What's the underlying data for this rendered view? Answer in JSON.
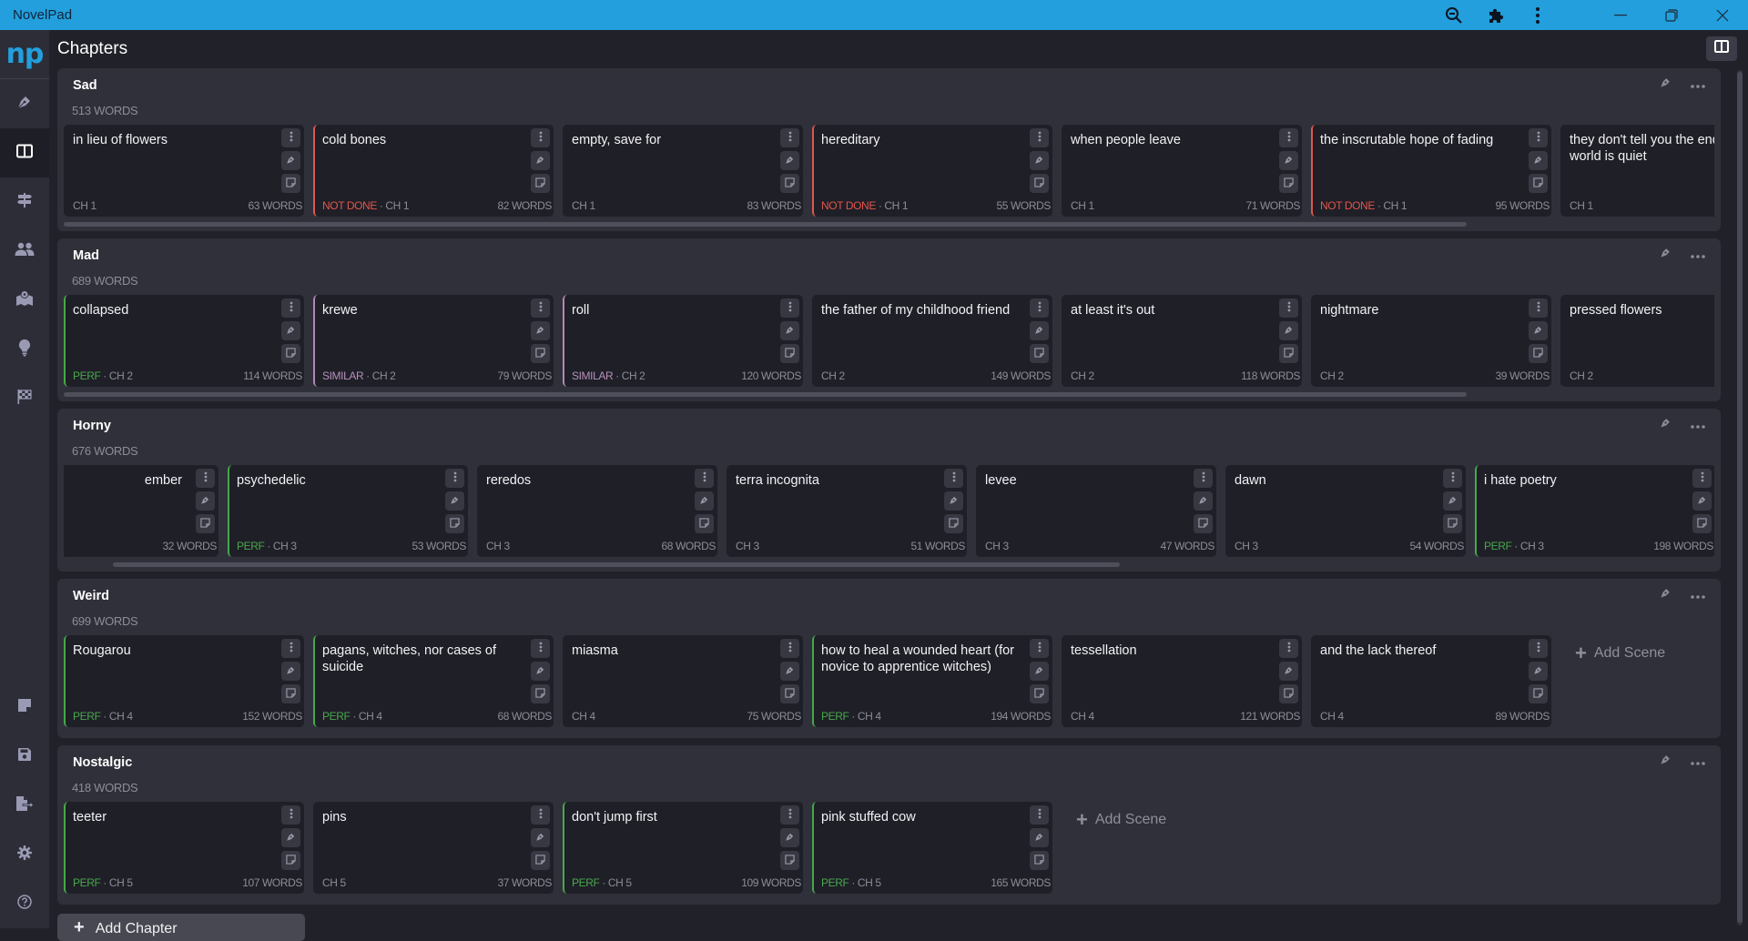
{
  "app": {
    "title": "NovelPad",
    "logo": "np",
    "page_title": "Chapters",
    "titlebar_icons": [
      "zoom-out-icon",
      "extension-puzzle-icon",
      "more-vert-icon"
    ],
    "window_controls": [
      "minimize",
      "restore",
      "close"
    ],
    "colors": {
      "titlebar": "#229fdc",
      "perf": "#48a84c",
      "not_done": "#e2554c",
      "similar": "#b791bd"
    }
  },
  "sidebar": {
    "top_items": [
      {
        "name": "write",
        "icon": "pen-nib-icon"
      },
      {
        "name": "chapters",
        "icon": "board-icon",
        "active": true
      },
      {
        "name": "plot",
        "icon": "signpost-icon"
      },
      {
        "name": "characters",
        "icon": "people-icon"
      },
      {
        "name": "locations",
        "icon": "map-pin-icon"
      },
      {
        "name": "ideas",
        "icon": "lightbulb-icon"
      },
      {
        "name": "goals",
        "icon": "checkered-flag-icon"
      }
    ],
    "bottom_items": [
      {
        "name": "notes",
        "icon": "sticky-note-icon"
      },
      {
        "name": "save",
        "icon": "floppy-disk-icon"
      },
      {
        "name": "export",
        "icon": "file-export-icon"
      },
      {
        "name": "settings",
        "icon": "gear-icon"
      },
      {
        "name": "help",
        "icon": "question-circle-icon"
      }
    ]
  },
  "chapters": [
    {
      "name": "Sad",
      "words": "513 WORDS",
      "scroll": {
        "thumb_start": 0.0,
        "thumb_end": 0.85
      },
      "offset": 0,
      "scenes": [
        {
          "title": "in lieu of flowers",
          "status": "",
          "chapter": "CH 1",
          "words": "63 WORDS"
        },
        {
          "title": "cold bones",
          "status": "NOT DONE",
          "chapter": "CH 1",
          "words": "82 WORDS"
        },
        {
          "title": "empty, save for",
          "status": "",
          "chapter": "CH 1",
          "words": "83 WORDS"
        },
        {
          "title": "hereditary",
          "status": "NOT DONE",
          "chapter": "CH 1",
          "words": "55 WORDS"
        },
        {
          "title": "when people leave",
          "status": "",
          "chapter": "CH 1",
          "words": "71 WORDS"
        },
        {
          "title": "the inscrutable hope of fading",
          "status": "NOT DONE",
          "chapter": "CH 1",
          "words": "95 WORDS"
        },
        {
          "title": "they don't tell you the end the world is quiet",
          "status": "",
          "chapter": "CH 1",
          "words": ""
        }
      ],
      "add_scene": ""
    },
    {
      "name": "Mad",
      "words": "689 WORDS",
      "scroll": {
        "thumb_start": 0.0,
        "thumb_end": 0.85
      },
      "offset": 0,
      "scenes": [
        {
          "title": "collapsed",
          "status": "PERF",
          "chapter": "CH 2",
          "words": "114 WORDS"
        },
        {
          "title": "krewe",
          "status": "SIMILAR",
          "chapter": "CH 2",
          "words": "79 WORDS"
        },
        {
          "title": "roll",
          "status": "SIMILAR",
          "chapter": "CH 2",
          "words": "120 WORDS"
        },
        {
          "title": "the father of my childhood friend",
          "status": "",
          "chapter": "CH 2",
          "words": "149 WORDS"
        },
        {
          "title": "at least it's out",
          "status": "",
          "chapter": "CH 2",
          "words": "118 WORDS"
        },
        {
          "title": "nightmare",
          "status": "",
          "chapter": "CH 2",
          "words": "39 WORDS"
        },
        {
          "title": "pressed flowers",
          "status": "",
          "chapter": "CH 2",
          "words": ""
        }
      ],
      "add_scene": ""
    },
    {
      "name": "Horny",
      "words": "676 WORDS",
      "scroll": {
        "thumb_start": 0.03,
        "thumb_end": 0.64
      },
      "offset": 1,
      "scenes": [
        {
          "title": "ember",
          "status": "",
          "chapter": "",
          "words": "32 WORDS"
        },
        {
          "title": "psychedelic",
          "status": "PERF",
          "chapter": "CH 3",
          "words": "53 WORDS"
        },
        {
          "title": "reredos",
          "status": "",
          "chapter": "CH 3",
          "words": "68 WORDS"
        },
        {
          "title": "terra incognita",
          "status": "",
          "chapter": "CH 3",
          "words": "51 WORDS"
        },
        {
          "title": "levee",
          "status": "",
          "chapter": "CH 3",
          "words": "47 WORDS"
        },
        {
          "title": "dawn",
          "status": "",
          "chapter": "CH 3",
          "words": "54 WORDS"
        },
        {
          "title": "i hate poetry",
          "status": "PERF",
          "chapter": "CH 3",
          "words": "198 WORDS"
        }
      ],
      "add_scene": ""
    },
    {
      "name": "Weird",
      "words": "699 WORDS",
      "scroll": null,
      "offset": 0,
      "scenes": [
        {
          "title": "Rougarou",
          "status": "PERF",
          "chapter": "CH 4",
          "words": "152 WORDS"
        },
        {
          "title": "pagans, witches, nor cases of suicide",
          "status": "PERF",
          "chapter": "CH 4",
          "words": "68 WORDS"
        },
        {
          "title": "miasma",
          "status": "",
          "chapter": "CH 4",
          "words": "75 WORDS"
        },
        {
          "title": "how to heal a wounded heart (for novice to apprentice witches)",
          "status": "PERF",
          "chapter": "CH 4",
          "words": "194 WORDS"
        },
        {
          "title": "tessellation",
          "status": "",
          "chapter": "CH 4",
          "words": "121 WORDS"
        },
        {
          "title": "and the lack thereof",
          "status": "",
          "chapter": "CH 4",
          "words": "89 WORDS"
        }
      ],
      "add_scene": "Add Scene"
    },
    {
      "name": "Nostalgic",
      "words": "418 WORDS",
      "scroll": null,
      "offset": 0,
      "scenes": [
        {
          "title": "teeter",
          "status": "PERF",
          "chapter": "CH 5",
          "words": "107 WORDS"
        },
        {
          "title": "pins",
          "status": "",
          "chapter": "CH 5",
          "words": "37 WORDS"
        },
        {
          "title": "don't jump first",
          "status": "PERF",
          "chapter": "CH 5",
          "words": "109 WORDS"
        },
        {
          "title": "pink stuffed cow",
          "status": "PERF",
          "chapter": "CH 5",
          "words": "165 WORDS"
        }
      ],
      "add_scene": "Add Scene"
    }
  ],
  "add_chapter": "Add Chapter"
}
